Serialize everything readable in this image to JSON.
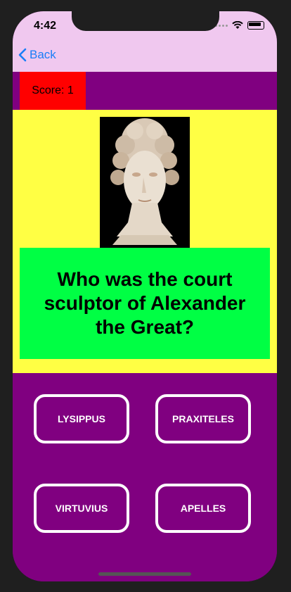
{
  "status": {
    "time": "4:42"
  },
  "nav": {
    "back_label": "Back"
  },
  "score": {
    "label": "Score: 1"
  },
  "question": {
    "text": "Who was the court sculptor of Alexander the Great?"
  },
  "answers": [
    {
      "label": "LYSIPPUS"
    },
    {
      "label": "PRAXITELES"
    },
    {
      "label": "VIRTUVIUS"
    },
    {
      "label": "APELLES"
    }
  ],
  "colors": {
    "nav_background": "#f0c8ef",
    "main_background": "#800080",
    "score_background": "#ff0000",
    "question_panel": "#ffff44",
    "question_box": "#00ff44",
    "accent_blue": "#1a7ef7"
  },
  "icons": {
    "back": "chevron-left-icon",
    "image": "sculpture-bust-image"
  }
}
